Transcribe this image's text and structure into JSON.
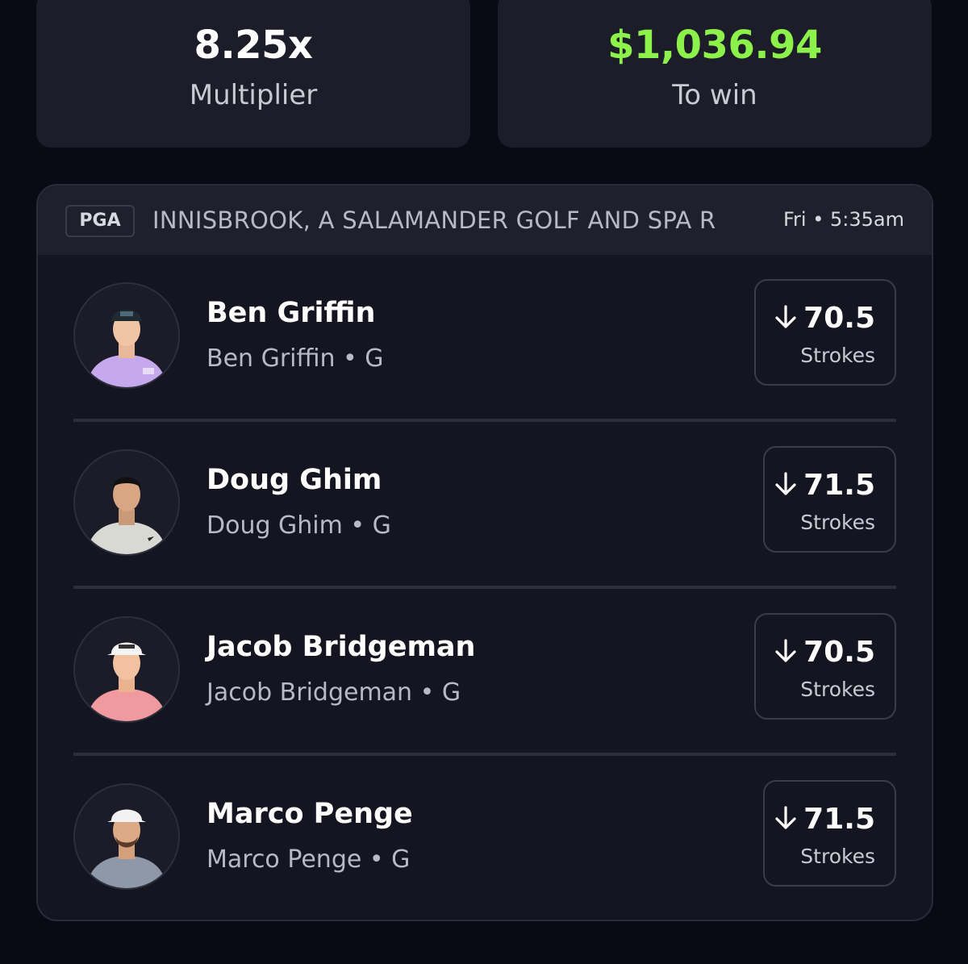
{
  "summary": {
    "multiplier_value": "8.25x",
    "multiplier_label": "Multiplier",
    "to_win_value": "$1,036.94",
    "to_win_label": "To win",
    "to_win_color": "#8cf24b"
  },
  "event": {
    "league": "PGA",
    "name": "INNISBROOK, A SALAMANDER GOLF AND SPA R",
    "time": "Fri • 5:35am"
  },
  "picks": [
    {
      "name": "Ben Griffin",
      "subtitle": "Ben Griffin • G",
      "line": "70.5",
      "stat": "Strokes",
      "direction": "under",
      "direction_icon": "arrow-down-icon"
    },
    {
      "name": "Doug Ghim",
      "subtitle": "Doug Ghim • G",
      "line": "71.5",
      "stat": "Strokes",
      "direction": "under",
      "direction_icon": "arrow-down-icon"
    },
    {
      "name": "Jacob Bridgeman",
      "subtitle": "Jacob Bridgeman • G",
      "line": "70.5",
      "stat": "Strokes",
      "direction": "under",
      "direction_icon": "arrow-down-icon"
    },
    {
      "name": "Marco Penge",
      "subtitle": "Marco Penge • G",
      "line": "71.5",
      "stat": "Strokes",
      "direction": "under",
      "direction_icon": "arrow-down-icon"
    }
  ]
}
